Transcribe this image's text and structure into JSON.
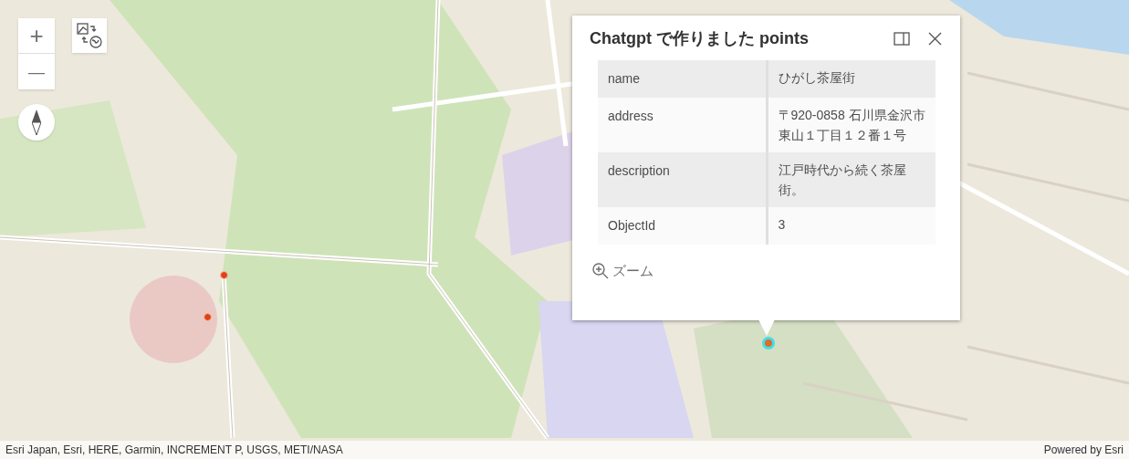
{
  "map": {
    "markers": [
      {
        "selected": false
      },
      {
        "selected": false
      },
      {
        "selected": true
      }
    ]
  },
  "zoom_controls": {
    "zoom_in": "+",
    "zoom_out": "—"
  },
  "popup": {
    "title": "Chatgpt で作りました points",
    "rows": [
      {
        "field": "name",
        "value": "ひがし茶屋街"
      },
      {
        "field": "address",
        "value": "〒920-0858 石川県金沢市東山１丁目１２番１号"
      },
      {
        "field": "description",
        "value": "江戸時代から続く茶屋街。"
      },
      {
        "field": "ObjectId",
        "value": "3"
      }
    ],
    "action": "ズーム"
  },
  "attribution": {
    "sources": "Esri Japan, Esri, HERE, Garmin, INCREMENT P, USGS, METI/NASA",
    "powered_by": "Powered by Esri"
  }
}
